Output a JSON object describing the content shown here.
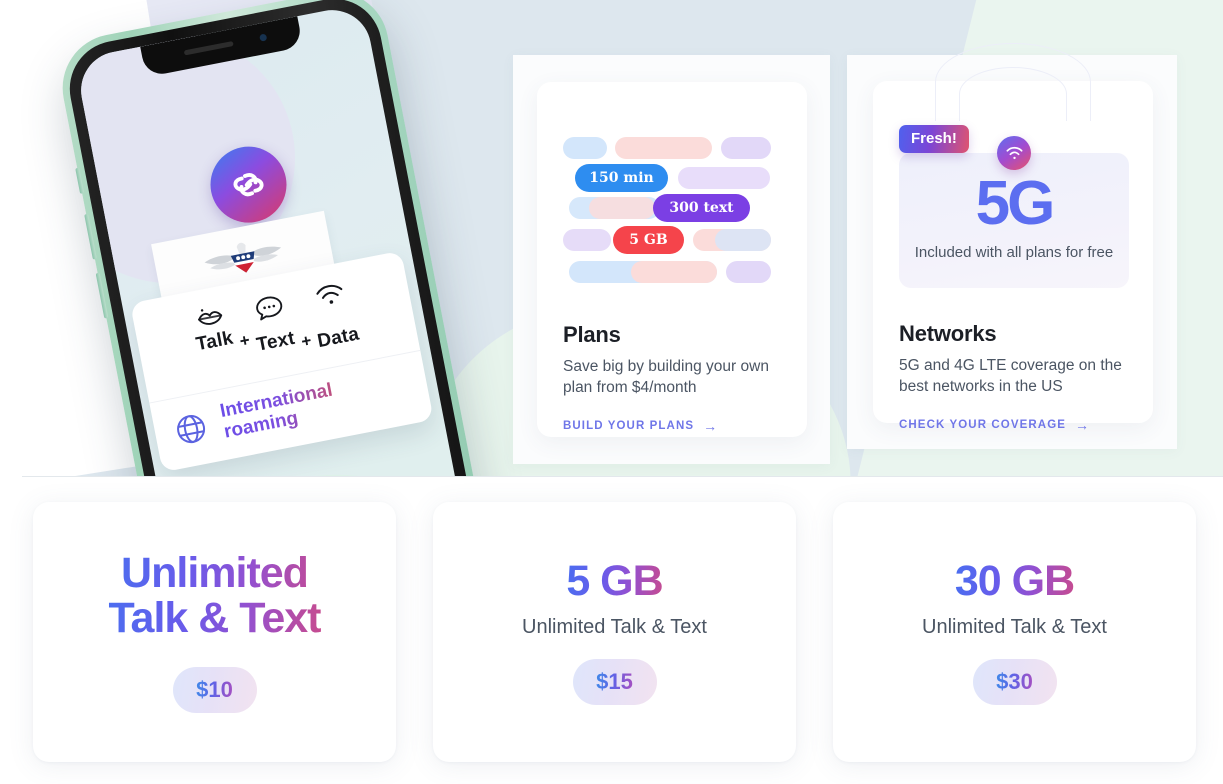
{
  "hero": {
    "phone": {
      "app_logo_icon": "infinity-link-logo-icon",
      "carrier_plate_icon": "patriot-eagle-logo-icon",
      "features": [
        {
          "icon": "lips-talk-icon",
          "label": "Talk"
        },
        {
          "icon": "plus-icon",
          "label": "+"
        },
        {
          "icon": "chat-bubble-text-icon",
          "label": "Text"
        },
        {
          "icon": "plus-icon",
          "label": "+"
        },
        {
          "icon": "wifi-data-icon",
          "label": "Data"
        }
      ],
      "roaming": {
        "icon": "globe-icon",
        "label": "International roaming"
      }
    }
  },
  "cards": {
    "plans": {
      "title": "Plans",
      "description": "Save big by building your own plan from $4/month",
      "link_label": "BUILD YOUR PLANS",
      "link_icon": "arrow-right-icon",
      "pills": [
        {
          "text": "150 min",
          "color": "#2e8df0"
        },
        {
          "text": "300 text",
          "color": "#7b3fe4"
        },
        {
          "text": "5 GB",
          "color": "#f5444b"
        }
      ],
      "decor_colors": [
        "#d3e6fb",
        "#fbdcda",
        "#e2d8f8",
        "#e8def8",
        "#fbe2e0",
        "#d9e9fb"
      ]
    },
    "networks": {
      "badge": "Fresh!",
      "badge_colors": [
        "#4f61ee",
        "#e0546f"
      ],
      "graphic_icon": "wifi-signal-icon",
      "graphic_headline": "5G",
      "graphic_headline_color": "#5c6ef0",
      "graphic_sub": "Included with all plans for free",
      "title": "Networks",
      "description": "5G and 4G LTE coverage on the best networks in the US",
      "link_label": "CHECK YOUR COVERAGE",
      "link_icon": "arrow-right-icon"
    }
  },
  "pricing": {
    "cards": [
      {
        "headline": "Unlimited\nTalk & Text",
        "headline_line1": "Unlimited",
        "headline_line2": "Talk & Text",
        "subtitle": "",
        "price": "$10"
      },
      {
        "headline": "5 GB",
        "headline_line1": "5 GB",
        "headline_line2": "",
        "subtitle": "Unlimited Talk & Text",
        "price": "$15"
      },
      {
        "headline": "30 GB",
        "headline_line1": "30 GB",
        "headline_line2": "",
        "subtitle": "Unlimited Talk & Text",
        "price": "$30"
      }
    ]
  },
  "colors": {
    "hero_background": "#dde7ee",
    "mint_accent": "#eaf5ef",
    "link": "#6f76e8",
    "gradient_start": "#4a6ef0",
    "gradient_end": "#c74b8f"
  }
}
